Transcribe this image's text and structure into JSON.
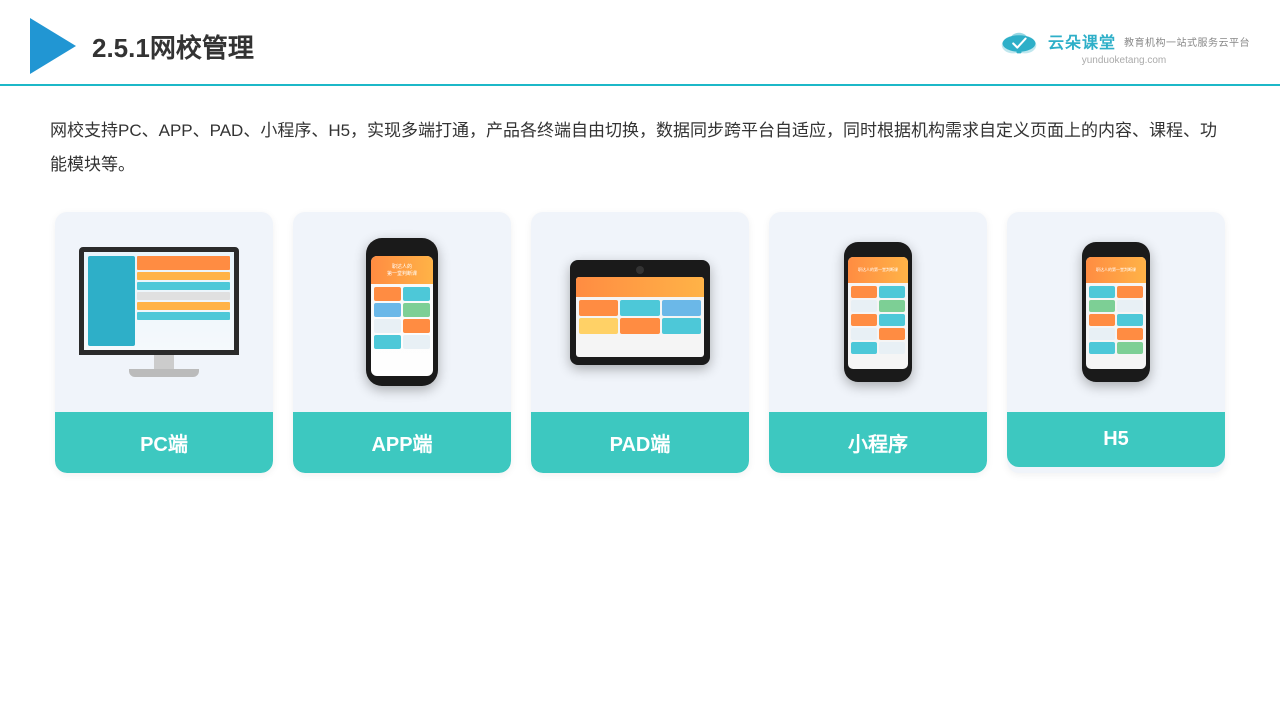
{
  "header": {
    "title": "2.5.1网校管理",
    "brand": {
      "name": "云朵课堂",
      "url": "yunduoketang.com",
      "subtitle": "教育机构一站式服务云平台"
    }
  },
  "description": "网校支持PC、APP、PAD、小程序、H5，实现多端打通，产品各终端自由切换，数据同步跨平台自适应，同时根据机构需求自定义页面上的内容、课程、功能模块等。",
  "cards": [
    {
      "id": "pc",
      "label": "PC端"
    },
    {
      "id": "app",
      "label": "APP端"
    },
    {
      "id": "pad",
      "label": "PAD端"
    },
    {
      "id": "miniprogram",
      "label": "小程序"
    },
    {
      "id": "h5",
      "label": "H5"
    }
  ]
}
